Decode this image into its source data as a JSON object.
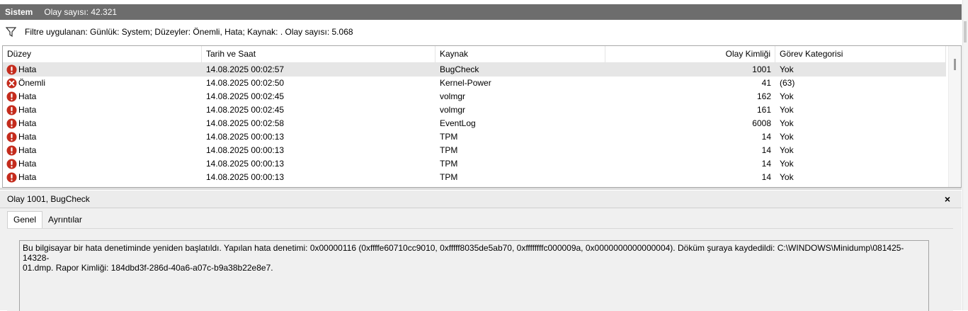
{
  "header": {
    "title": "Sistem",
    "event_count": "Olay sayısı: 42.321"
  },
  "filter": {
    "text": "Filtre uygulanan: Günlük: System; Düzeyler: Önemli, Hata; Kaynak: . Olay sayısı: 5.068"
  },
  "table": {
    "columns": [
      "Düzey",
      "Tarih ve Saat",
      "Kaynak",
      "Olay Kimliği",
      "Görev Kategorisi"
    ],
    "rows": [
      {
        "level": "Hata",
        "icon": "error-icon",
        "datetime": "14.08.2025 00:02:57",
        "source": "BugCheck",
        "event_id": "1001",
        "task": "Yok"
      },
      {
        "level": "Önemli",
        "icon": "critical-icon",
        "datetime": "14.08.2025 00:02:50",
        "source": "Kernel-Power",
        "event_id": "41",
        "task": "(63)"
      },
      {
        "level": "Hata",
        "icon": "error-icon",
        "datetime": "14.08.2025 00:02:45",
        "source": "volmgr",
        "event_id": "162",
        "task": "Yok"
      },
      {
        "level": "Hata",
        "icon": "error-icon",
        "datetime": "14.08.2025 00:02:45",
        "source": "volmgr",
        "event_id": "161",
        "task": "Yok"
      },
      {
        "level": "Hata",
        "icon": "error-icon",
        "datetime": "14.08.2025 00:02:58",
        "source": "EventLog",
        "event_id": "6008",
        "task": "Yok"
      },
      {
        "level": "Hata",
        "icon": "error-icon",
        "datetime": "14.08.2025 00:00:13",
        "source": "TPM",
        "event_id": "14",
        "task": "Yok"
      },
      {
        "level": "Hata",
        "icon": "error-icon",
        "datetime": "14.08.2025 00:00:13",
        "source": "TPM",
        "event_id": "14",
        "task": "Yok"
      },
      {
        "level": "Hata",
        "icon": "error-icon",
        "datetime": "14.08.2025 00:00:13",
        "source": "TPM",
        "event_id": "14",
        "task": "Yok"
      },
      {
        "level": "Hata",
        "icon": "error-icon",
        "datetime": "14.08.2025 00:00:13",
        "source": "TPM",
        "event_id": "14",
        "task": "Yok"
      }
    ]
  },
  "detail": {
    "title": "Olay 1001, BugCheck",
    "close_glyph": "×",
    "tabs": [
      "Genel",
      "Ayrıntılar"
    ],
    "description": "Bu bilgisayar bir hata denetiminde yeniden başlatıldı. Yapılan hata denetimi: 0x00000116 (0xffffe60710cc9010, 0xfffff8035de5ab70, 0xffffffffc000009a, 0x0000000000000004). Döküm şuraya kaydedildi: C:\\WINDOWS\\Minidump\\081425-14328-\n01.dmp. Rapor Kimliği: 184dbd3f-286d-40a6-a07c-b9a38b22e8e7."
  },
  "colors": {
    "header_bg": "#6d6d6d",
    "error_icon": "#c42b1c",
    "selected_row": "#e6e6e6"
  }
}
